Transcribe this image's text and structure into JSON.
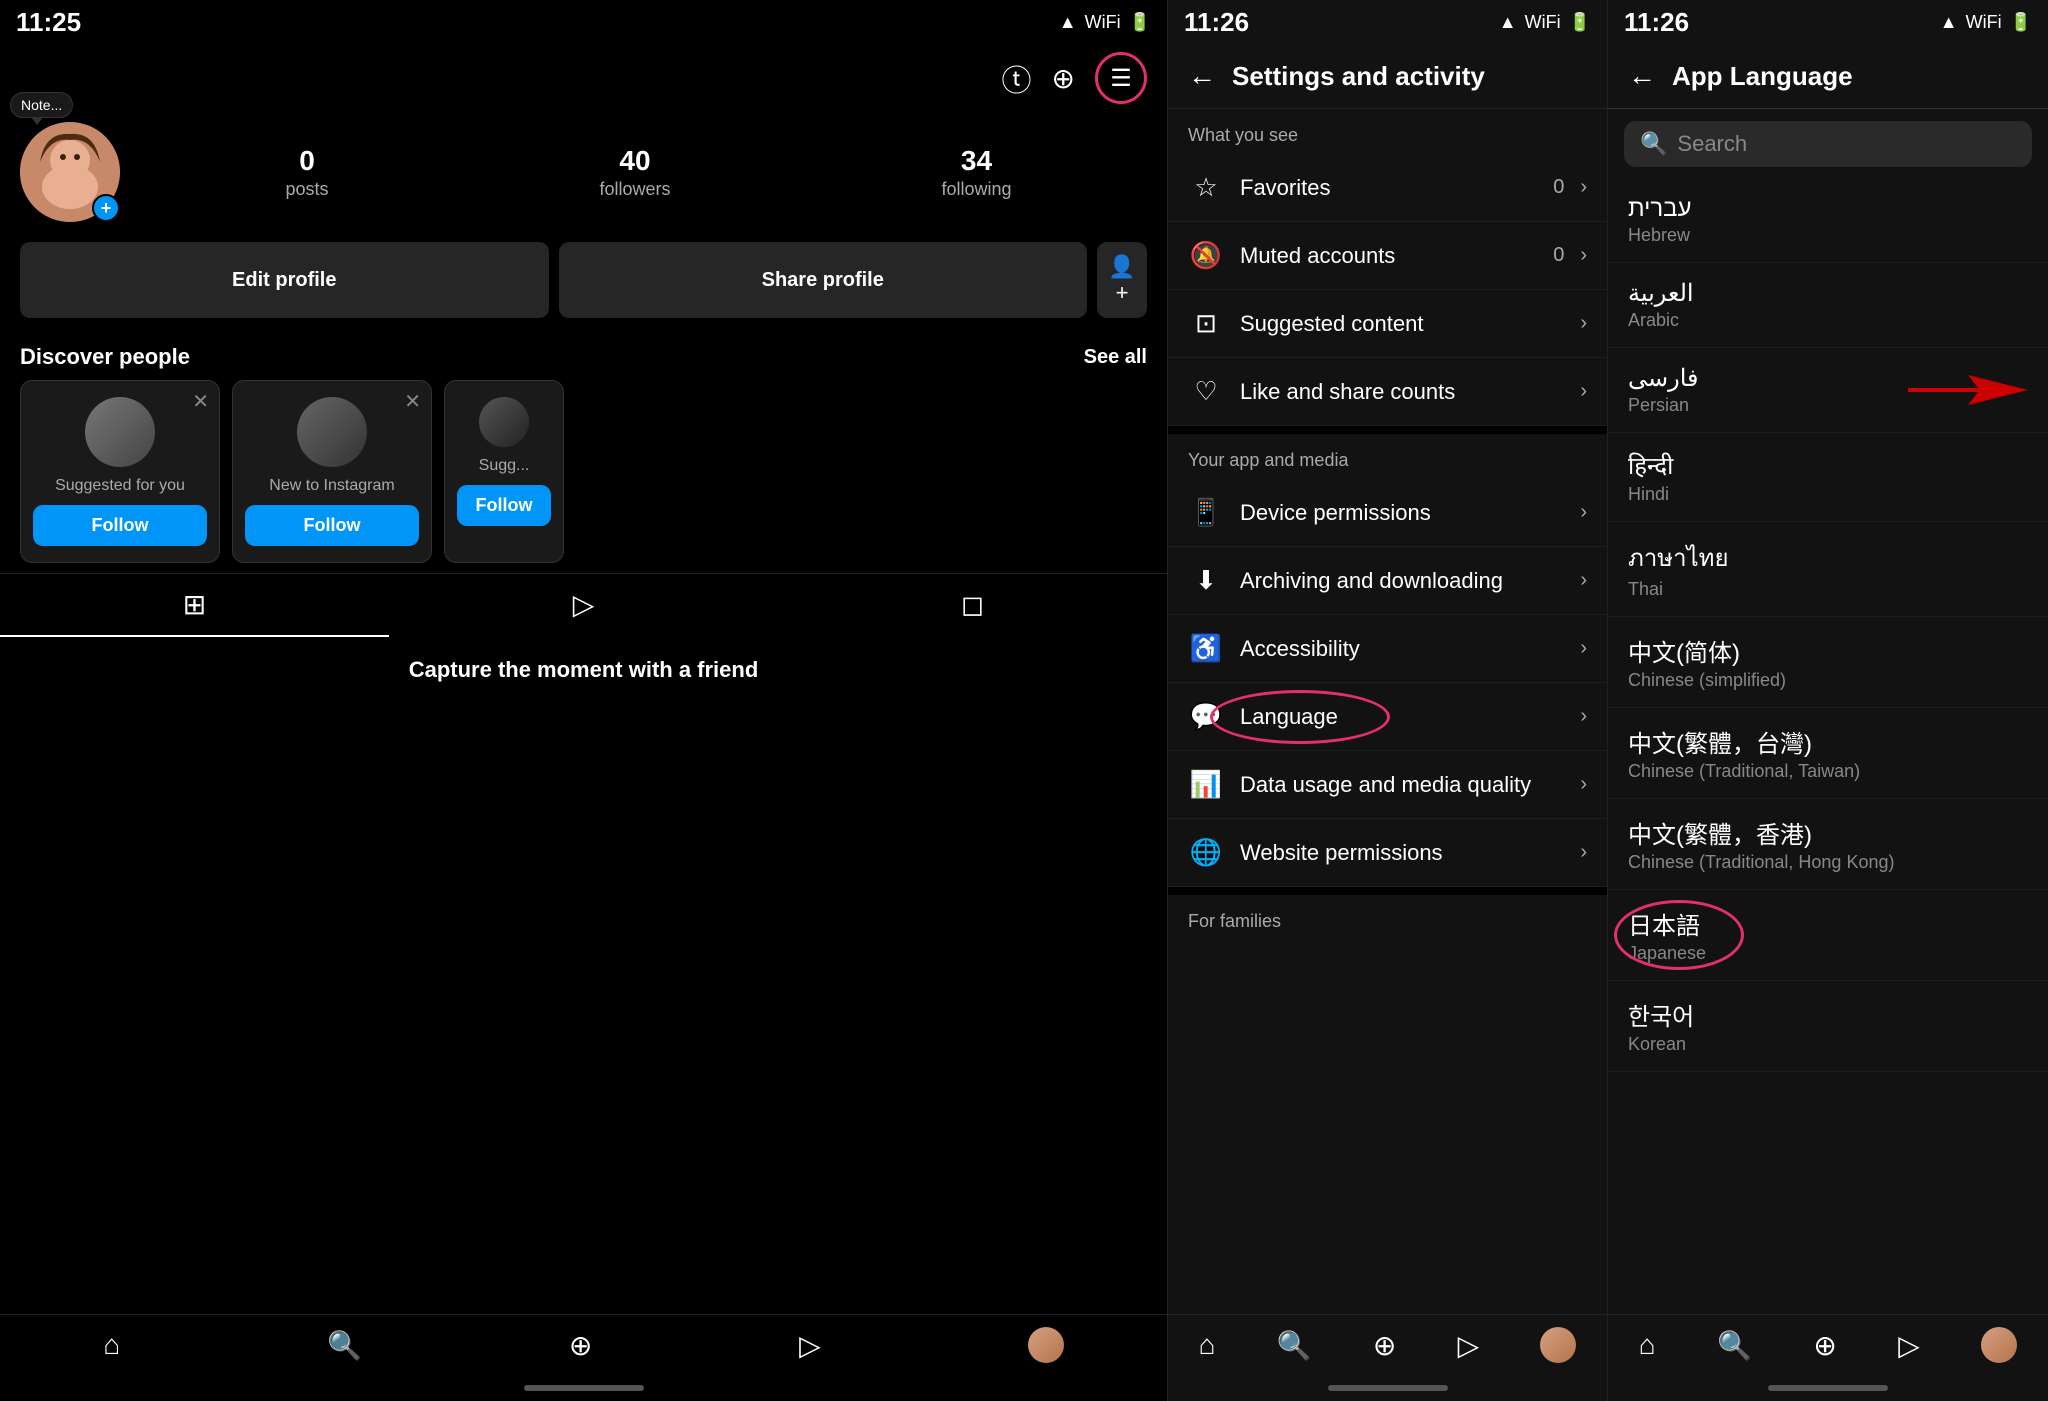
{
  "panel1": {
    "statusbar": {
      "time": "11:25",
      "icons": [
        "signal",
        "wifi",
        "battery"
      ]
    },
    "topnav": {
      "threads_label": "①",
      "add_label": "⊕",
      "menu_label": "☰"
    },
    "note": {
      "text": "Note..."
    },
    "stats": {
      "posts": {
        "value": "0",
        "label": "posts"
      },
      "followers": {
        "value": "40",
        "label": "followers"
      },
      "following": {
        "value": "34",
        "label": "following"
      }
    },
    "buttons": {
      "edit_profile": "Edit profile",
      "share_profile": "Share profile"
    },
    "discover": {
      "title": "Discover people",
      "see_all": "See all"
    },
    "cards": [
      {
        "label": "Suggested for you",
        "follow": "Follow"
      },
      {
        "label": "New to Instagram",
        "follow": "Follow"
      },
      {
        "label": "Suggested",
        "follow": "Follow"
      }
    ],
    "profile_tabs": [
      "⊞",
      "▷",
      "◻"
    ],
    "capture_banner": "Capture the moment with a friend",
    "nav_icons": [
      "⌂",
      "🔍",
      "⊕",
      "▷",
      "👤"
    ]
  },
  "panel2": {
    "statusbar": {
      "time": "11:26"
    },
    "header": {
      "back": "←",
      "title": "Settings and activity"
    },
    "what_you_see": {
      "label": "What you see",
      "items": [
        {
          "icon": "☆",
          "text": "Favorites",
          "badge": "0",
          "chevron": "›"
        },
        {
          "icon": "🔕",
          "text": "Muted accounts",
          "badge": "0",
          "chevron": "›"
        },
        {
          "icon": "⊡",
          "text": "Suggested content",
          "badge": "",
          "chevron": "›"
        },
        {
          "icon": "♡",
          "text": "Like and share counts",
          "badge": "",
          "chevron": "›"
        }
      ]
    },
    "your_app": {
      "label": "Your app and media",
      "items": [
        {
          "icon": "📱",
          "text": "Device permissions",
          "badge": "",
          "chevron": "›"
        },
        {
          "icon": "⬇",
          "text": "Archiving and downloading",
          "badge": "",
          "chevron": "›"
        },
        {
          "icon": "♿",
          "text": "Accessibility",
          "badge": "",
          "chevron": "›"
        },
        {
          "icon": "💬",
          "text": "Language",
          "badge": "",
          "chevron": "›"
        },
        {
          "icon": "📊",
          "text": "Data usage and media quality",
          "badge": "",
          "chevron": "›"
        },
        {
          "icon": "🌐",
          "text": "Website permissions",
          "badge": "",
          "chevron": "›"
        }
      ]
    },
    "for_families": {
      "label": "For families"
    },
    "nav_icons": [
      "⌂",
      "🔍",
      "⊕",
      "▷",
      "👤"
    ]
  },
  "panel3": {
    "statusbar": {
      "time": "11:26"
    },
    "header": {
      "back": "←",
      "title": "App Language"
    },
    "search": {
      "placeholder": "Search"
    },
    "languages": [
      {
        "native": "עברית",
        "english": "Hebrew"
      },
      {
        "native": "العربية",
        "english": "Arabic"
      },
      {
        "native": "فارسی",
        "english": "Persian",
        "arrow": true
      },
      {
        "native": "हिन्दी",
        "english": "Hindi"
      },
      {
        "native": "ภาษาไทย",
        "english": "Thai"
      },
      {
        "native": "中文(简体)",
        "english": "Chinese (simplified)"
      },
      {
        "native": "中文(繁體，台灣)",
        "english": "Chinese (Traditional, Taiwan)"
      },
      {
        "native": "中文(繁體，香港)",
        "english": "Chinese (Traditional, Hong Kong)"
      },
      {
        "native": "日本語",
        "english": "Japanese",
        "circle": true
      },
      {
        "native": "한국어",
        "english": "Korean"
      }
    ],
    "nav_icons": [
      "⌂",
      "🔍",
      "⊕",
      "▷",
      "👤"
    ]
  }
}
